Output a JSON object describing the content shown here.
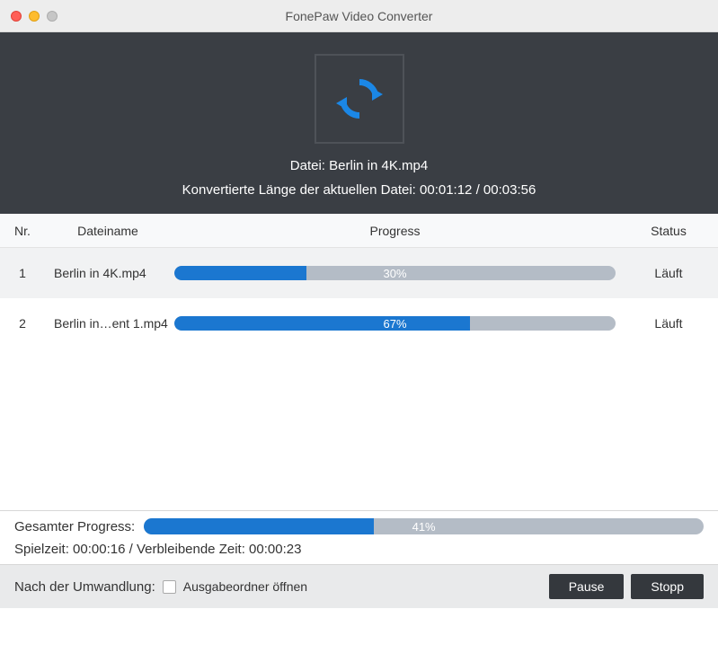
{
  "window": {
    "title": "FonePaw Video Converter"
  },
  "hero": {
    "file_label_prefix": "Datei: ",
    "current_file": "Berlin in 4K.mp4",
    "converted_prefix": "Konvertierte Länge der aktuellen Datei: ",
    "converted_time": "00:01:12",
    "separator": " / ",
    "total_time": "00:03:56"
  },
  "columns": {
    "nr": "Nr.",
    "name": "Dateiname",
    "progress": "Progress",
    "status": "Status"
  },
  "rows": [
    {
      "nr": "1",
      "name": "Berlin in 4K.mp4",
      "percent": 30,
      "percent_label": "30%",
      "status": "Läuft"
    },
    {
      "nr": "2",
      "name": "Berlin in…ent 1.mp4",
      "percent": 67,
      "percent_label": "67%",
      "status": "Läuft"
    }
  ],
  "overall": {
    "label": "Gesamter Progress:",
    "percent": 41,
    "percent_label": "41%"
  },
  "times": {
    "played_label": "Spielzeit: ",
    "played": "00:00:16",
    "sep": " / ",
    "remaining_label": "Verbleibende Zeit: ",
    "remaining": "00:00:23"
  },
  "after": {
    "label": "Nach der Umwandlung:",
    "checkbox_label": "Ausgabeordner öffnen",
    "checked": false
  },
  "buttons": {
    "pause": "Pause",
    "stop": "Stopp"
  },
  "colors": {
    "progress_fill": "#1b77d0",
    "progress_track": "#b4bcc6"
  }
}
